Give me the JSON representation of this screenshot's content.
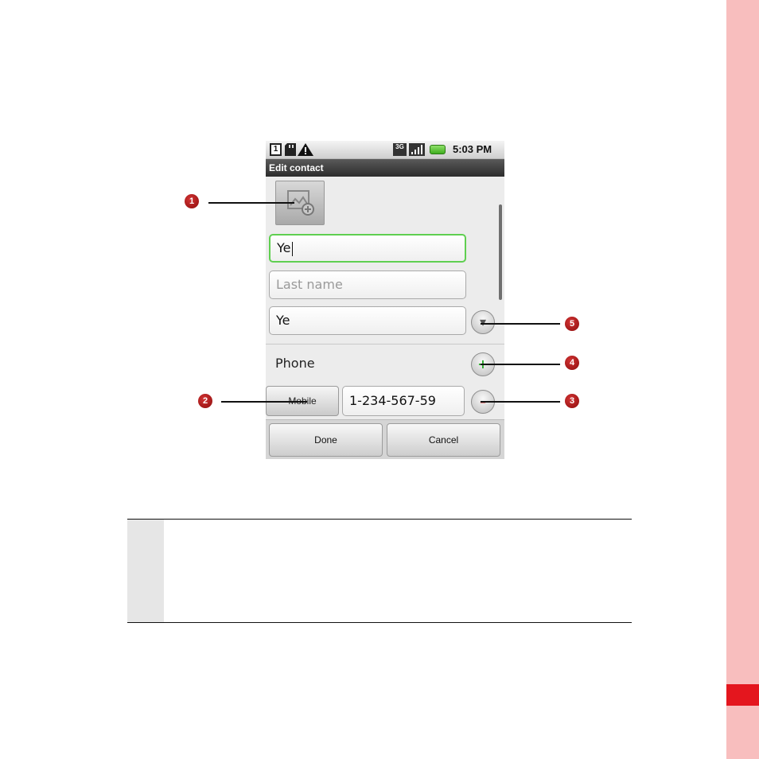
{
  "screen": {
    "status_bar": {
      "sim_slot": "1",
      "network": "3G",
      "time": "5:03 PM",
      "icons": [
        "sim-card-icon",
        "sd-card-icon",
        "warning-icon",
        "3g-icon",
        "signal-icon",
        "battery-icon"
      ]
    },
    "title": "Edit contact",
    "form": {
      "first_name_value": "Ye",
      "last_name_placeholder": "Last name",
      "third_field_value": "Ye",
      "phone_section_label": "Phone",
      "phone_type_label": "Mobile",
      "phone_number_value": "1-234-567-59"
    },
    "buttons": {
      "done": "Done",
      "cancel": "Cancel"
    }
  },
  "callouts": [
    "1",
    "2",
    "3",
    "4",
    "5"
  ],
  "colors": {
    "focus_border": "#5fcf50",
    "side_strip": "#f8bebe",
    "side_tab": "#e4161e",
    "callout_badge": "#b01616"
  }
}
